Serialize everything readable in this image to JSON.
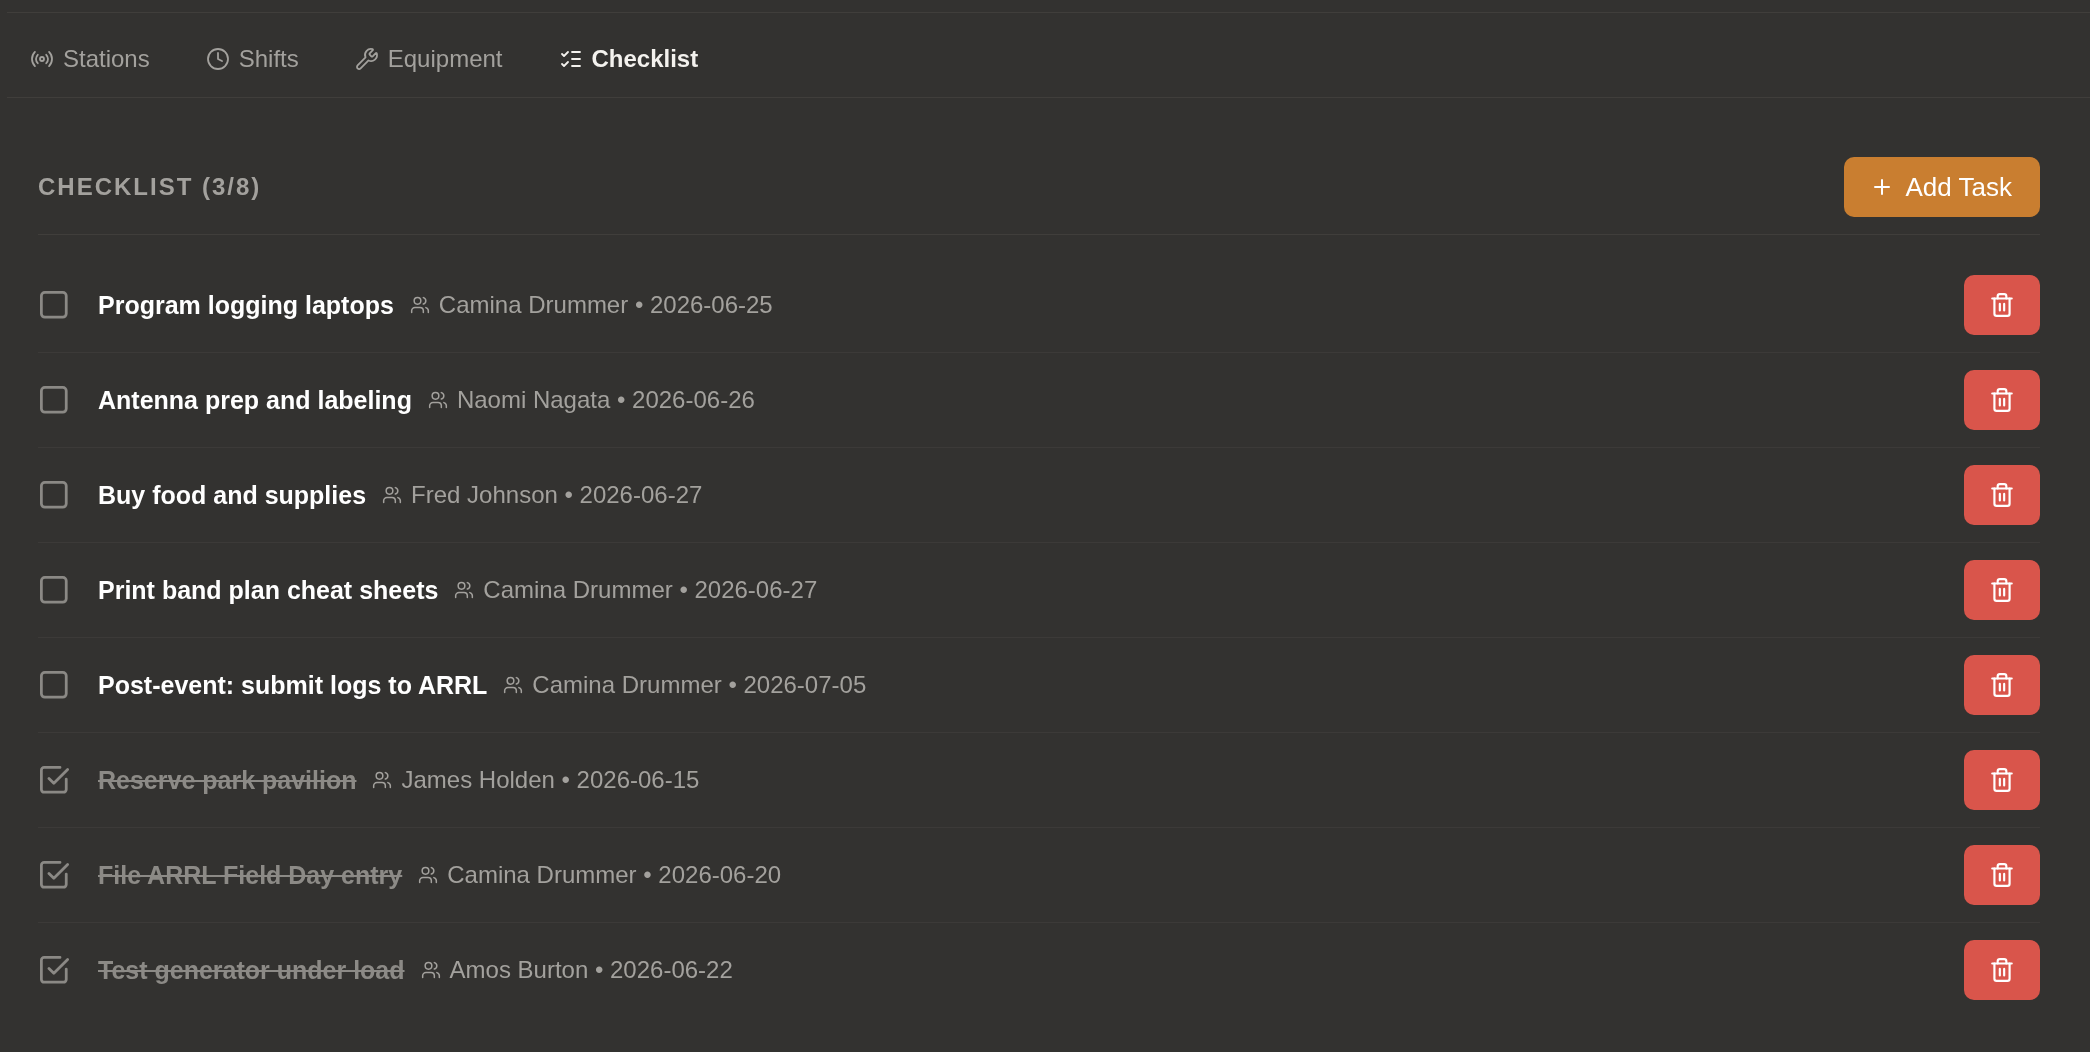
{
  "tabs": [
    {
      "label": "Stations",
      "selected": false
    },
    {
      "label": "Shifts",
      "selected": false
    },
    {
      "label": "Equipment",
      "selected": false
    },
    {
      "label": "Checklist",
      "selected": true
    }
  ],
  "checklist": {
    "title": "CHECKLIST (3/8)",
    "add_button": "Add Task",
    "tasks": [
      {
        "title": "Program logging laptops",
        "meta": "Camina Drummer • 2026-06-25",
        "checked": false
      },
      {
        "title": "Antenna prep and labeling",
        "meta": "Naomi Nagata • 2026-06-26",
        "checked": false
      },
      {
        "title": "Buy food and supplies",
        "meta": "Fred Johnson • 2026-06-27",
        "checked": false
      },
      {
        "title": "Print band plan cheat sheets",
        "meta": "Camina Drummer • 2026-06-27",
        "checked": false
      },
      {
        "title": "Post-event: submit logs to ARRL",
        "meta": "Camina Drummer • 2026-07-05",
        "checked": false
      },
      {
        "title": "Reserve park pavilion",
        "meta": "James Holden • 2026-06-15",
        "checked": true
      },
      {
        "title": "File ARRL Field Day entry",
        "meta": "Camina Drummer • 2026-06-20",
        "checked": true
      },
      {
        "title": "Test generator under load",
        "meta": "Amos Burton • 2026-06-22",
        "checked": true
      }
    ]
  }
}
